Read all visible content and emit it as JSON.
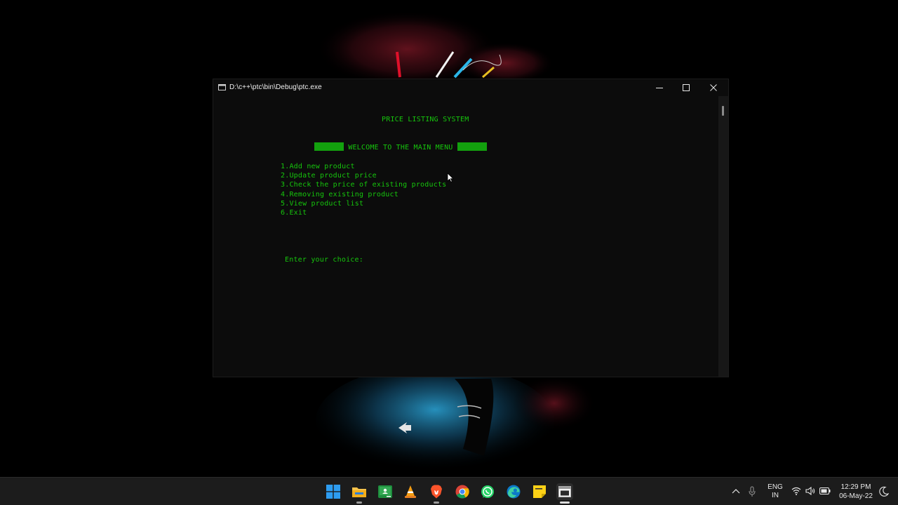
{
  "window": {
    "title": "D:\\c++\\ptc\\bin\\Debug\\ptc.exe"
  },
  "console": {
    "system_title": "PRICE LISTING SYSTEM",
    "welcome": "WELCOME TO THE MAIN MENU",
    "menu_items": [
      "1.Add new product",
      "2.Update product price",
      "3.Check the price of existing products",
      "4.Removing existing product",
      "5.View product list",
      "6.Exit"
    ],
    "prompt": "Enter your choice:",
    "text_color": "#16c60c",
    "block_color": "#13a10e",
    "background": "#0c0c0c"
  },
  "taskbar": {
    "apps": [
      {
        "name": "windows-start",
        "icon": "windows-icon"
      },
      {
        "name": "file-explorer",
        "icon": "folder-icon"
      },
      {
        "name": "google-classroom",
        "icon": "classroom-icon"
      },
      {
        "name": "vlc",
        "icon": "vlc-cone-icon"
      },
      {
        "name": "brave",
        "icon": "brave-lion-icon"
      },
      {
        "name": "chrome",
        "icon": "chrome-icon"
      },
      {
        "name": "whatsapp",
        "icon": "whatsapp-icon"
      },
      {
        "name": "edge",
        "icon": "edge-icon"
      },
      {
        "name": "sticky-notes",
        "icon": "sticky-notes-icon"
      },
      {
        "name": "console",
        "icon": "console-icon"
      }
    ],
    "tray": {
      "lang_line1": "ENG",
      "lang_line2": "IN",
      "time": "12:29 PM",
      "date": "06-May-22"
    }
  }
}
